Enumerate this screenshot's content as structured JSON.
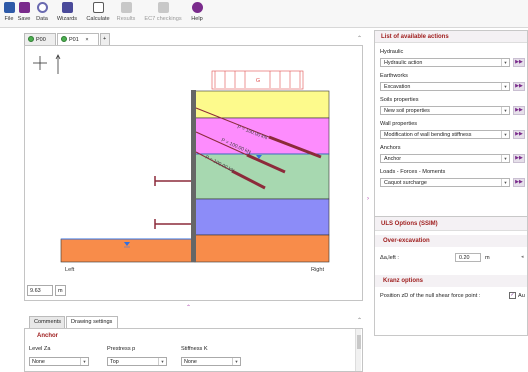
{
  "toolbar": {
    "items": [
      {
        "label": "File",
        "disabled": false,
        "color": "#2e5aa8"
      },
      {
        "label": "Save",
        "disabled": false,
        "color": "#7a2b8c"
      },
      {
        "label": "Data",
        "disabled": false,
        "color": "#6a6ab0"
      },
      {
        "label": "Wizards",
        "disabled": false,
        "color": "#4a4a9a"
      },
      {
        "label": "Calculate",
        "disabled": false,
        "color": "#5a5a5a"
      },
      {
        "label": "Results",
        "disabled": true,
        "color": "#9a9a9a"
      },
      {
        "label": "EC7 checkings",
        "disabled": true,
        "color": "#9a9a9a"
      },
      {
        "label": "Help",
        "disabled": false,
        "color": "#7a2b8c"
      }
    ]
  },
  "doc_tabs": [
    {
      "label": "P00"
    },
    {
      "label": "P01",
      "close": "×",
      "add": "+"
    }
  ],
  "drawing": {
    "load_label": "G",
    "anchor_labels": [
      "P = 100.00 kN",
      "P = 100.00 kN",
      "P = 100.00 kN"
    ],
    "left_label": "Left",
    "right_label": "Right",
    "zoom_value": "9.63",
    "zoom_unit": "m",
    "colors": {
      "layer_yellow": "#fdfa8c",
      "layer_magenta": "#fd8cfd",
      "layer_green": "#a7d8b0",
      "layer_blue": "#8c8cf8",
      "layer_orange": "#f88c4a",
      "anchor": "#8c2a3a",
      "wall": "#666666",
      "load": "#e05050"
    }
  },
  "bottom": {
    "tabs": [
      "Comments",
      "Drawing settings"
    ],
    "section_title": "Anchor",
    "fields": [
      {
        "label": "Level Za",
        "value": "None"
      },
      {
        "label": "Prestress p",
        "value": "Top"
      },
      {
        "label": "Stiffness K",
        "value": "None"
      }
    ]
  },
  "right_panel": {
    "title": "List of available actions",
    "groups": [
      {
        "label": "Hydraulic",
        "value": "Hydraulic action"
      },
      {
        "label": "Earthworks",
        "value": "Excavation"
      },
      {
        "label": "Soils properties",
        "value": "New soil properties"
      },
      {
        "label": "Wall properties",
        "value": "Modification of wall bending stiffness"
      },
      {
        "label": "Anchors",
        "value": "Anchor"
      },
      {
        "label": "Loads - Forces - Moments",
        "value": "Caquot surcharge"
      }
    ],
    "go_label": "▶▶"
  },
  "uls": {
    "title": "ULS Options (SSIM)",
    "over_excavation_title": "Over-excavation",
    "delta_label": "Δa,left :",
    "delta_value": "0.20",
    "delta_unit": "m",
    "kranz_title": "Kranz options",
    "position_label": "Position zD of the null shear force point :",
    "auto_label": "Au",
    "auto_checked": true
  }
}
